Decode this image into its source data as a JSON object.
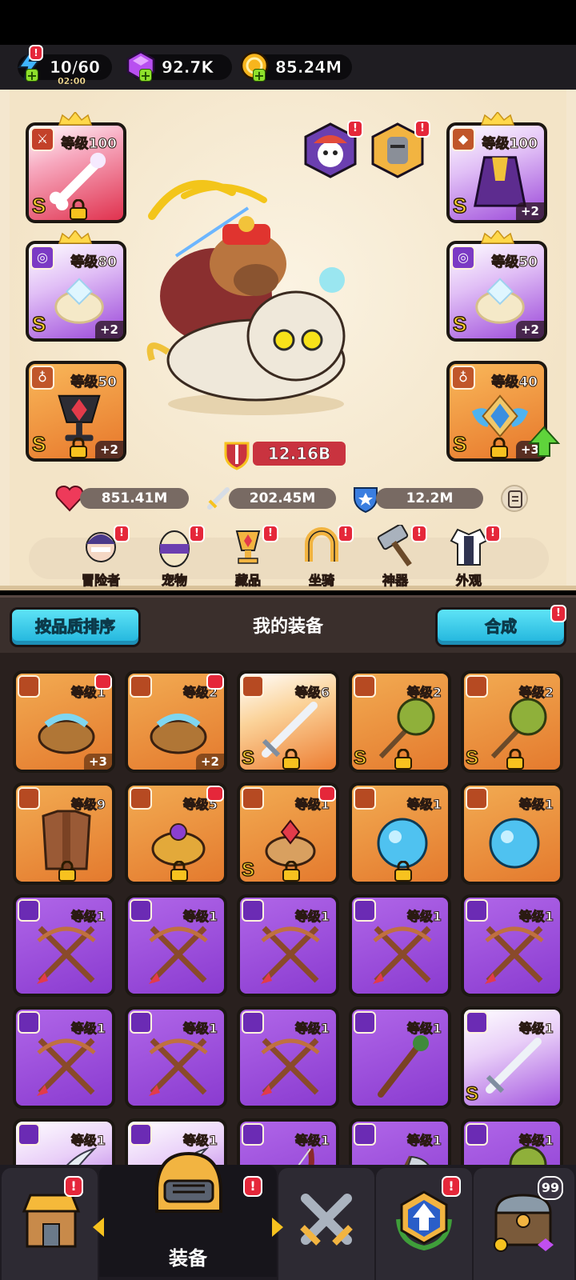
{
  "resources": {
    "energy": {
      "value": "10/60",
      "timer": "02:00",
      "icon": "lightning-icon"
    },
    "gems": {
      "value": "92.7K",
      "icon": "purple-gem-icon"
    },
    "coins": {
      "value": "85.24M",
      "icon": "gold-coin-icon"
    }
  },
  "equipped": {
    "weapon": {
      "level": "等级100",
      "rank": "S",
      "icon": "bone-weapon-icon"
    },
    "armor": {
      "level": "等级100",
      "rank": "S",
      "plus": "+2",
      "icon": "cape-armor-icon"
    },
    "ring_left": {
      "level": "等级80",
      "rank": "S",
      "plus": "+2",
      "icon": "crystal-ring-icon"
    },
    "ring_right": {
      "level": "等级50",
      "rank": "S",
      "plus": "+2",
      "icon": "crystal-ring-icon"
    },
    "necklace_left": {
      "level": "等级50",
      "rank": "S",
      "plus": "+2",
      "icon": "chalice-necklace-icon"
    },
    "necklace_right": {
      "level": "等级40",
      "rank": "S",
      "plus": "+3",
      "icon": "winged-emblem-icon"
    }
  },
  "power": "12.16B",
  "stats": {
    "hp": "851.41M",
    "attack": "202.45M",
    "defense": "12.2M"
  },
  "categories": [
    {
      "label": "冒险者",
      "icon": "adventurer-icon"
    },
    {
      "label": "宠物",
      "icon": "pet-egg-icon"
    },
    {
      "label": "藏品",
      "icon": "trophy-icon"
    },
    {
      "label": "坐骑",
      "icon": "horseshoe-icon"
    },
    {
      "label": "神器",
      "icon": "hammer-icon"
    },
    {
      "label": "外观",
      "icon": "outfit-icon"
    }
  ],
  "section": {
    "sort_label": "按品质排序",
    "title": "我的装备",
    "merge_label": "合成"
  },
  "inventory": [
    {
      "level": "等级1",
      "plus": "+3",
      "rank": "",
      "color": "orange",
      "icon": "bracelet-icon"
    },
    {
      "level": "等级2",
      "plus": "+2",
      "rank": "",
      "color": "orange",
      "icon": "bracelet-icon"
    },
    {
      "level": "等级6",
      "plus": "",
      "rank": "S",
      "color": "orange",
      "icon": "sword-icon"
    },
    {
      "level": "等级2",
      "plus": "",
      "rank": "S",
      "color": "orange",
      "icon": "mace-icon"
    },
    {
      "level": "等级2",
      "plus": "",
      "rank": "S",
      "color": "orange",
      "icon": "mace-icon"
    },
    {
      "level": "等级9",
      "plus": "",
      "rank": "",
      "color": "orange",
      "icon": "leather-armor-icon"
    },
    {
      "level": "等级5",
      "plus": "",
      "rank": "",
      "color": "orange",
      "icon": "gold-ring-icon"
    },
    {
      "level": "等级1",
      "plus": "",
      "rank": "S",
      "color": "orange",
      "icon": "ruby-ring-icon"
    },
    {
      "level": "等级1",
      "plus": "",
      "rank": "",
      "color": "orange",
      "icon": "blue-orb-icon"
    },
    {
      "level": "等级1",
      "plus": "",
      "rank": "",
      "color": "orange",
      "icon": "blue-orb-icon"
    },
    {
      "level": "等级1",
      "plus": "",
      "rank": "",
      "color": "purple",
      "icon": "crossed-arrows-icon"
    },
    {
      "level": "等级1",
      "plus": "",
      "rank": "",
      "color": "purple",
      "icon": "crossed-arrows-icon"
    },
    {
      "level": "等级1",
      "plus": "",
      "rank": "",
      "color": "purple",
      "icon": "crossed-arrows-icon"
    },
    {
      "level": "等级1",
      "plus": "",
      "rank": "",
      "color": "purple",
      "icon": "crossed-arrows-icon"
    },
    {
      "level": "等级1",
      "plus": "",
      "rank": "",
      "color": "purple",
      "icon": "crossed-arrows-icon"
    },
    {
      "level": "等级1",
      "plus": "",
      "rank": "",
      "color": "purple",
      "icon": "crossed-arrows-icon"
    },
    {
      "level": "等级1",
      "plus": "",
      "rank": "",
      "color": "purple",
      "icon": "crossed-arrows-icon"
    },
    {
      "level": "等级1",
      "plus": "",
      "rank": "",
      "color": "purple",
      "icon": "crossed-arrows-icon"
    },
    {
      "level": "等级1",
      "plus": "",
      "rank": "",
      "color": "purple",
      "icon": "staff-icon"
    },
    {
      "level": "等级1",
      "plus": "",
      "rank": "S",
      "color": "purple",
      "icon": "sword-icon"
    },
    {
      "level": "等级1",
      "plus": "",
      "rank": "",
      "color": "purple",
      "icon": "blade-icon"
    },
    {
      "level": "等级1",
      "plus": "",
      "rank": "",
      "color": "purple",
      "icon": "blade-icon"
    },
    {
      "level": "等级1",
      "plus": "",
      "rank": "",
      "color": "purple",
      "icon": "bow-icon"
    },
    {
      "level": "等级1",
      "plus": "",
      "rank": "",
      "color": "purple",
      "icon": "scythe-icon"
    },
    {
      "level": "等级1",
      "plus": "",
      "rank": "",
      "color": "purple",
      "icon": "mace-icon"
    }
  ],
  "nav": {
    "tabs": [
      {
        "label": "",
        "icon": "shop-icon",
        "badge": "!"
      },
      {
        "label": "装备",
        "icon": "helmet-icon",
        "badge": "!"
      },
      {
        "label": "",
        "icon": "crossed-swords-icon",
        "badge": ""
      },
      {
        "label": "",
        "icon": "upgrade-arrow-icon",
        "badge": "!"
      },
      {
        "label": "",
        "icon": "treasure-chest-icon",
        "badge": "99"
      }
    ]
  },
  "colors": {
    "orange_rarity": "#e7772b",
    "purple_rarity": "#8a3bd0",
    "red_rarity": "#e0324e",
    "accent_blue": "#1fb3dc",
    "badge_red": "#e5273a"
  }
}
